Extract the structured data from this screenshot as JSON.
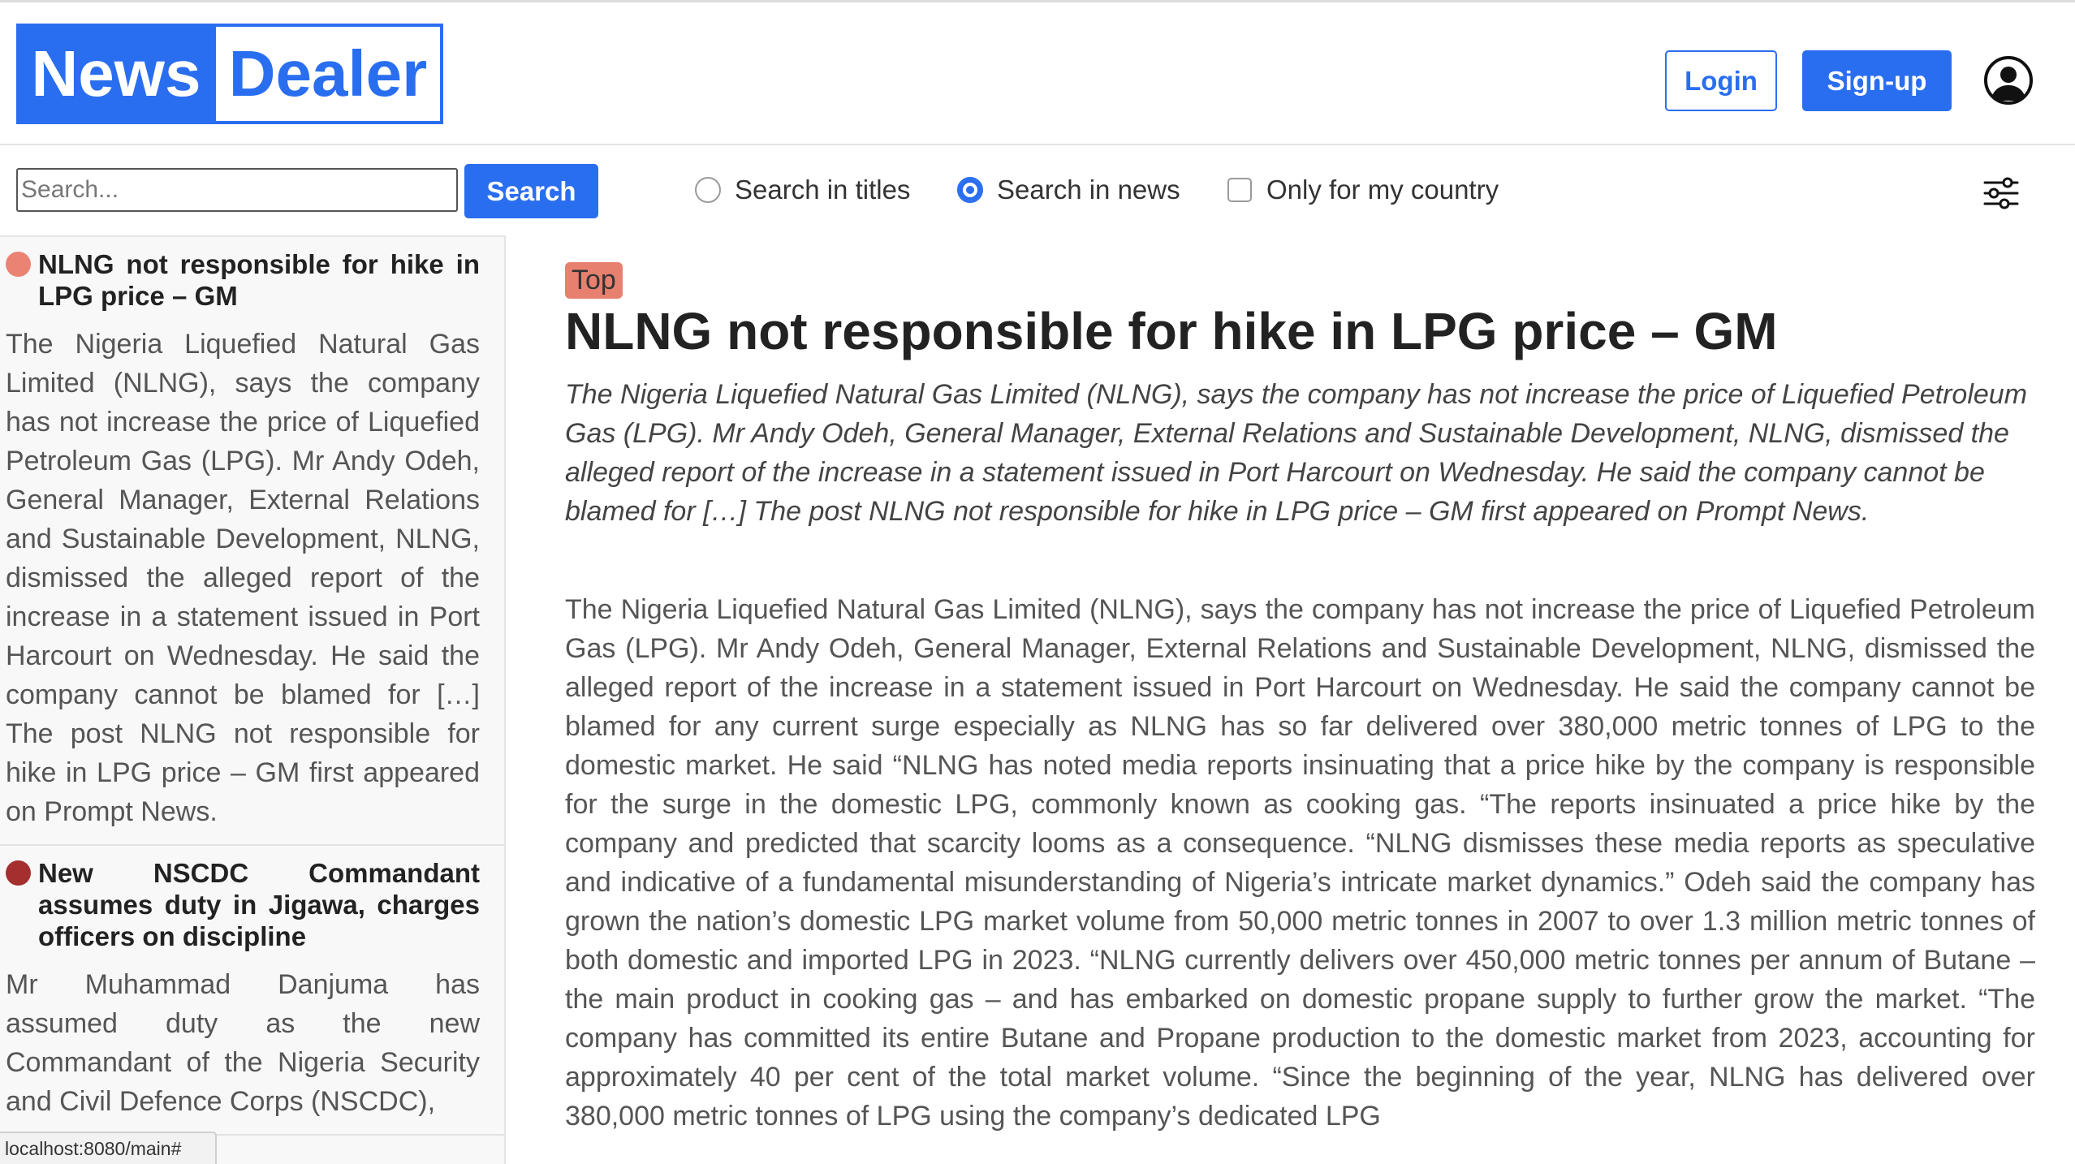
{
  "header": {
    "logo_left": "News",
    "logo_right": "Dealer",
    "login_label": "Login",
    "signup_label": "Sign-up",
    "user_icon": "user-circle-icon"
  },
  "search": {
    "placeholder": "Search...",
    "value": "",
    "button_label": "Search",
    "options": [
      {
        "type": "radio",
        "label": "Search in titles",
        "checked": false
      },
      {
        "type": "radio",
        "label": "Search in news",
        "checked": true
      },
      {
        "type": "checkbox",
        "label": "Only for my country",
        "checked": false
      }
    ],
    "filter_icon": "sliders-icon"
  },
  "sidebar": {
    "items": [
      {
        "title": "NLNG not responsible for hike in LPG price – GM",
        "summary": "The Nigeria Liquefied Natural Gas Limited (NLNG), says the company has not increase the price of Liquefied Petroleum Gas (LPG). Mr Andy Odeh, General Manager, External Relations and Sustainable Development, NLNG, dismissed the alleged report of the increase in a statement issued in Port Harcourt on Wednesday. He said the company cannot be blamed for […] The post NLNG not responsible for hike in LPG price – GM first appeared on Prompt News.",
        "dot_color": "#ea8373"
      },
      {
        "title": "New NSCDC Commandant assumes duty in Jigawa, charges officers on discipline",
        "summary": "Mr Muhammad Danjuma has assumed duty as the new Commandant of the Nigeria Security and Civil Defence Corps (NSCDC),",
        "dot_color": "#a3302f"
      }
    ]
  },
  "article": {
    "badge": "Top",
    "title": "NLNG not responsible for hike in LPG price – GM",
    "summary": "The Nigeria Liquefied Natural Gas Limited (NLNG), says the company has not increase the price of Liquefied Petroleum Gas (LPG). Mr Andy Odeh, General Manager, External Relations and Sustainable Development, NLNG, dismissed the alleged report of the increase in a statement issued in Port Harcourt on Wednesday. He said the company cannot be blamed for […] The post NLNG not responsible for hike in LPG price – GM first appeared on Prompt News.",
    "body": "The Nigeria Liquefied Natural Gas Limited (NLNG), says the company has not increase the price of Liquefied Petroleum Gas (LPG). Mr Andy Odeh, General Manager, External Relations and Sustainable Development, NLNG, dismissed the alleged report of the increase in a statement issued in Port Harcourt on Wednesday. He said the company cannot be blamed for any current surge especially as NLNG has so far delivered over 380,000 metric tonnes of LPG to the domestic market. He said “NLNG has noted media reports insinuating that a price hike by the company is responsible for the surge in the domestic LPG, commonly known as cooking gas. “The reports insinuated a price hike by the company and predicted that scarcity looms as a consequence. “NLNG dismisses these media reports as speculative and indicative of a fundamental misunderstanding of Nigeria’s intricate market dynamics.” Odeh said the company has grown the nation’s domestic LPG market volume from 50,000 metric tonnes in 2007 to over 1.3 million metric tonnes of both domestic and imported LPG in 2023. “NLNG currently delivers over 450,000 metric tonnes per annum of Butane – the main product in cooking gas – and has embarked on domestic propane supply to further grow the market. “The company has committed its entire Butane and Propane production to the domestic market from 2023, accounting for approximately 40 per cent of the total market volume. “Since the beginning of the year, NLNG has delivered over 380,000 metric tonnes of LPG using the company’s dedicated LPG"
  },
  "status_bar": {
    "url": "localhost:8080/main#"
  },
  "colors": {
    "brand_blue": "#2a6ef0",
    "top_badge": "#e8806f"
  }
}
